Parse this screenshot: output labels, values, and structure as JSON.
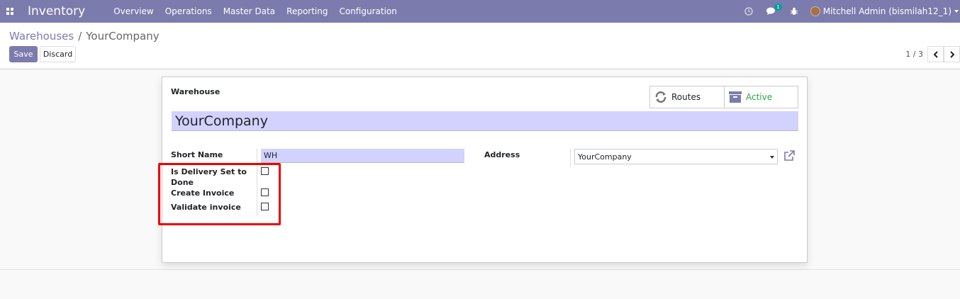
{
  "navbar": {
    "app_name": "Inventory",
    "menus": [
      "Overview",
      "Operations",
      "Master Data",
      "Reporting",
      "Configuration"
    ],
    "badge_count": "1",
    "user_name": "Mitchell Admin (bismilah12_1)"
  },
  "breadcrumb": {
    "parent": "Warehouses",
    "separator": "/",
    "current": "YourCompany"
  },
  "buttons": {
    "save": "Save",
    "discard": "Discard"
  },
  "pager": {
    "value": "1 / 3"
  },
  "form": {
    "warehouse_label": "Warehouse",
    "warehouse_name": "YourCompany",
    "smart_buttons": {
      "routes": "Routes",
      "active": "Active"
    },
    "short_name_label": "Short Name",
    "short_name_value": "WH",
    "address_label": "Address",
    "address_value": "YourCompany",
    "delivery_label_line1": "Is Delivery Set to",
    "delivery_label_line2": "Done",
    "create_invoice_label": "Create Invoice",
    "validate_invoice_label": "Validate invoice"
  },
  "colors": {
    "navbar": "#7c7bad",
    "input_bg": "#d2d2ff",
    "highlight": "#ee0000",
    "active": "#28a745"
  }
}
